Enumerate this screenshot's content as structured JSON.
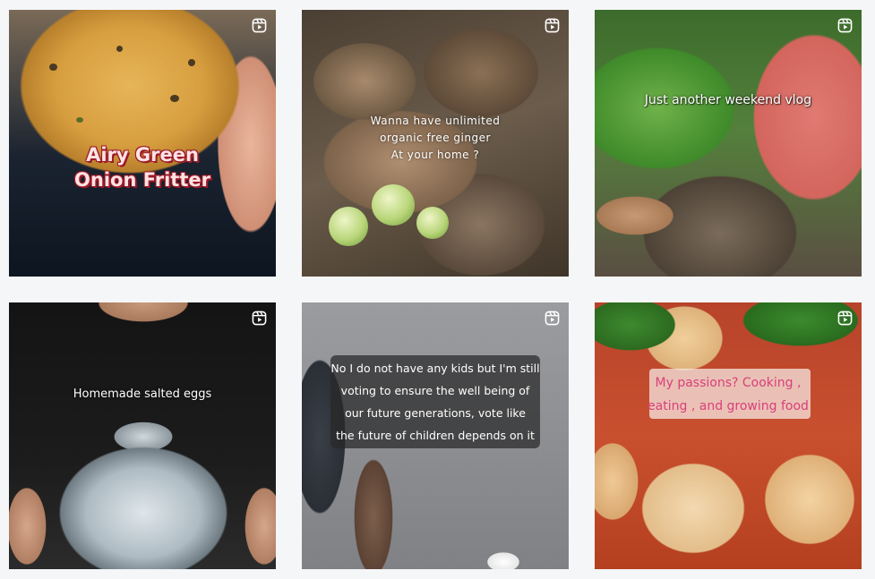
{
  "feed": {
    "posts": [
      {
        "caption": "Airy Green\nOnion Fritter",
        "type_icon": "reel-icon"
      },
      {
        "caption": "Wanna have unlimited\norganic free ginger\nAt your home ?",
        "type_icon": "reel-icon"
      },
      {
        "caption": "Just another weekend vlog",
        "type_icon": "reel-icon"
      },
      {
        "caption": "Homemade salted eggs",
        "type_icon": "reel-icon"
      },
      {
        "caption": "No I do not have any kids but I'm still\nvoting to ensure the well being of\nour future generations, vote like\nthe future of children depends on it",
        "type_icon": "reel-icon"
      },
      {
        "caption": "My passions? Cooking ,\neating , and growing food",
        "type_icon": "reel-icon"
      }
    ]
  },
  "colors": {
    "page_background": "#f5f6f8",
    "reel_icon": "#ffffff",
    "caption_pink": "#d8407a",
    "caption_red_outline": "#9c1b2a"
  }
}
